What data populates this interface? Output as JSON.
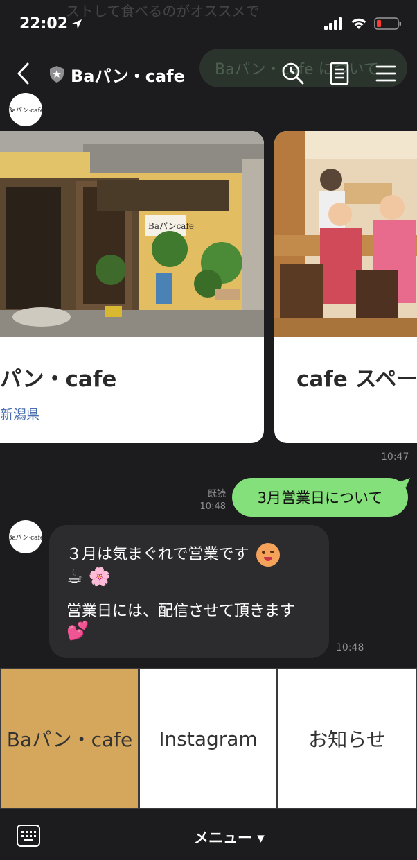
{
  "status": {
    "time": "22:02"
  },
  "background_text": {
    "top": "ストして食べるのがオススメで"
  },
  "header": {
    "title": "Baパン・cafe",
    "faded_bubble": "Baパン・cafe について"
  },
  "avatar_logo": "Baパン·cafe",
  "carousel": {
    "cards": [
      {
        "title": "パン・cafe",
        "subtitle": "新潟県"
      },
      {
        "title": "cafe スペー",
        "subtitle": ""
      }
    ],
    "time": "10:47",
    "shop_sign": "Baパンcafe"
  },
  "sent_message": {
    "text": "3月営業日について",
    "read_label": "既読",
    "time": "10:48"
  },
  "received_message": {
    "line1": "３月は気まぐれで営業です",
    "line2_emoji": "☕ 🌸",
    "line3": "営業日には、配信させて頂きます",
    "line4_emoji": "💕",
    "time": "10:48"
  },
  "rich_menu": {
    "items": [
      {
        "label": "Baパン・cafe",
        "bg": "#d4a75c"
      },
      {
        "label": "Instagram",
        "bg": "#ffffff"
      },
      {
        "label": "お知らせ",
        "bg": "#ffffff"
      }
    ]
  },
  "bottom_bar": {
    "menu_label": "メニュー ▾"
  }
}
